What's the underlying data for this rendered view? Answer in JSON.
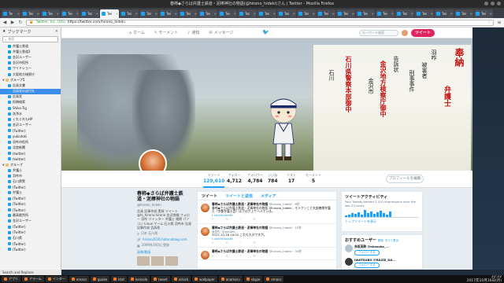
{
  "window": {
    "title": "春柿◆さらば弁護士鉄道・泥棒神社の物語(@hirono_hideki)さん | Twitter - Mozilla Firefox"
  },
  "tabs": [
    {
      "label": "Tw"
    },
    {
      "label": "Twi"
    },
    {
      "label": "Twi"
    },
    {
      "label": "Twi"
    },
    {
      "label": "Twi"
    },
    {
      "label": "Twi"
    },
    {
      "label": "Twi"
    },
    {
      "label": "Twi"
    },
    {
      "label": "Twi"
    },
    {
      "label": "Twi"
    },
    {
      "label": "Twi"
    },
    {
      "label": "Twi"
    },
    {
      "label": "Twi"
    },
    {
      "label": "Twi"
    },
    {
      "label": "Twi"
    },
    {
      "label": "Twi"
    },
    {
      "label": "Twi"
    },
    {
      "label": "Twi"
    },
    {
      "label": "Twi"
    },
    {
      "label": "Twi"
    },
    {
      "label": "Twi"
    },
    {
      "label": "Twi"
    },
    {
      "label": "Twi"
    },
    {
      "label": "Twi"
    },
    {
      "label": "Twi"
    }
  ],
  "navbar": {
    "back": "◀",
    "forward": "▶",
    "reload": "↻",
    "org": "Twitter, Inc. (US)",
    "url": "https://twitter.com/hirono_hideki"
  },
  "sidebar": {
    "title": "ブックマーク",
    "search_placeholder": "検索",
    "items": [
      {
        "label": "弁護士鉄道",
        "type": "hatena",
        "level": 1
      },
      {
        "label": "弁護士鉄道2",
        "type": "hatena",
        "level": 1
      },
      {
        "label": "金沢ユーザー",
        "type": "link",
        "level": 1
      },
      {
        "label": "金沢市役所",
        "type": "link",
        "level": 1
      },
      {
        "label": "ワイドショー",
        "type": "link",
        "level": 1
      },
      {
        "label": "大阪地方検察庁",
        "type": "link",
        "level": 1
      },
      {
        "label": "グループ5",
        "type": "folder",
        "level": 0
      },
      {
        "label": "告発文書",
        "type": "link",
        "level": 1
      },
      {
        "label": "告訴状の送付先",
        "type": "link",
        "level": 1,
        "selected": true
      },
      {
        "label": "告発状",
        "type": "link",
        "level": 1
      },
      {
        "label": "投稿検索",
        "type": "link",
        "level": 1
      },
      {
        "label": "Shiko-Tig",
        "type": "link",
        "level": 1
      },
      {
        "label": "洗浄水",
        "type": "link",
        "level": 1
      },
      {
        "label": "くれぐれもHP",
        "type": "link",
        "level": 1
      },
      {
        "label": "金沢ユーザー",
        "type": "link",
        "level": 1
      },
      {
        "label": "(Twitter)",
        "type": "link",
        "level": 1
      },
      {
        "label": "yukiotoki",
        "type": "link",
        "level": 1
      },
      {
        "label": "羽咋市役所",
        "type": "link",
        "level": 1
      },
      {
        "label": "北陸新聞",
        "type": "link",
        "level": 1
      },
      {
        "label": "(twitter)",
        "type": "link",
        "level": 1
      },
      {
        "label": "(twitter)",
        "type": "link",
        "level": 1
      },
      {
        "label": "グループ",
        "type": "folder",
        "level": 0
      },
      {
        "label": "弁護士",
        "type": "link",
        "level": 1
      },
      {
        "label": "羽咋市",
        "type": "link",
        "level": 1
      },
      {
        "label": "石川県警",
        "type": "link",
        "level": 1
      },
      {
        "label": "(Twitter)",
        "type": "link",
        "level": 1
      },
      {
        "label": "弁護士",
        "type": "link",
        "level": 1
      },
      {
        "label": "(Twitter)",
        "type": "link",
        "level": 1
      },
      {
        "label": "(Twitter)",
        "type": "link",
        "level": 1
      },
      {
        "label": "(Twitter)",
        "type": "link",
        "level": 1
      },
      {
        "label": "最高裁判所",
        "type": "link",
        "level": 1
      },
      {
        "label": "金沢ユーザー",
        "type": "link",
        "level": 1
      },
      {
        "label": "(Twitter)",
        "type": "link",
        "level": 1
      },
      {
        "label": "(Twitter)",
        "type": "link",
        "level": 1
      },
      {
        "label": "石川県",
        "type": "link",
        "level": 1
      },
      {
        "label": "(Twitter)",
        "type": "link",
        "level": 1
      },
      {
        "label": "(Twitter)",
        "type": "link",
        "level": 1
      }
    ]
  },
  "twitter_nav": {
    "home": "ホーム",
    "moments": "モーメント",
    "notifications": "通知",
    "messages": "メッセージ",
    "search_placeholder": "キーワード検索",
    "tweet_button": "ツイート"
  },
  "banner": {
    "col1": "奉納",
    "col2": "弁護士",
    "col3": "金沢地方検察庁御中",
    "col4": "石川県警察本部御中",
    "col5": "刑事事件",
    "col6": "羽咋",
    "col7": "被害者",
    "col8": "告訴状",
    "col9": "金沢市",
    "col10": "石川"
  },
  "stats": [
    {
      "label": "ツイート",
      "value": "129,610",
      "active": true
    },
    {
      "label": "フォロー",
      "value": "4,712"
    },
    {
      "label": "フォロワー",
      "value": "4,784"
    },
    {
      "label": "いいね",
      "value": "784"
    },
    {
      "label": "リスト",
      "value": "17"
    },
    {
      "label": "モーメント",
      "value": "5"
    }
  ],
  "edit_profile": "プロフィールを編集",
  "profile": {
    "name": "春柿◆さらば弁護士鉄道・泥棒神社の物語",
    "handle": "@hirono_hideki",
    "bio": "告発 記事作成 実録 ツイート @hi_hirono hirono 金沢地検 フォロー 羽咋 ツイッター 弁護士 検察 パソコン Linux ゲーム 石川県 羽咋市 告発 記事作成 告訴状",
    "location": "日本 石川県",
    "link": "hirono2016.hatenablog.com",
    "joined": "2009年10月に登録",
    "photos_header": "画像/動画"
  },
  "timeline": {
    "tab_tweets": "ツイート",
    "tab_replies": "ツイートと返信",
    "tab_media": "メディア",
    "tweets": [
      {
        "name": "春柿◆さらば弁護士鉄道・泥棒神社の物語",
        "handle": "@hirono_hideki · 6秒",
        "text": "春柿◆さらば弁護士鉄道・泥棒神社の物語 @hirono_hideki - モトケンこと矢部善朗弁護士（京都弁護士会）はブログ上でハメている。",
        "link": "t.co/xhironote"
      },
      {
        "name": "春柿◆さらば弁護士鉄道・泥棒神社の物語",
        "handle": "@hirono_hideki · 15秒",
        "text": "2017-10-16 10:04 これも大分ですが。",
        "link": "t.co/xhironote",
        "retweet": "返信先: @yjpubkt"
      },
      {
        "name": "春柿◆さらば弁護士鉄道・泥棒神社の物語",
        "handle": "@hirono_hideki · 30秒",
        "text": "",
        "link": "",
        "retweet": ""
      }
    ],
    "actions": [
      "↩",
      "⟲",
      "♡",
      "✉"
    ]
  },
  "activity": {
    "title": "ツイートアクティビティ",
    "desc": "Your Tweets earned 3,410 impressions over the last 24 hours",
    "link": "トップツイートを表示",
    "bars": [
      0.2,
      0.3,
      0.5,
      0.4,
      0.6,
      0.3,
      0.9,
      0.5,
      0.7,
      0.4,
      0.6,
      0.8,
      0.5,
      0.3,
      0.7
    ]
  },
  "recommendations": {
    "title": "おすすめユーザー",
    "refresh": "更新",
    "all": "すべて表示",
    "users": [
      {
        "name": "赤坂英幹 @akasaka_...",
        "follow": "フォローする"
      },
      {
        "name": "IWATSUBO @RAIZE_DA...",
        "follow": "フォローする"
      }
    ]
  },
  "status": {
    "text": "Search and Replace"
  },
  "taskbar": {
    "items": [
      "アプリ",
      "アラーム",
      "インター",
      "emacs",
      "guake",
      "ktxt",
      "konsole",
      "tweet",
      "xclock",
      "wallpaper",
      "anamaru",
      "skype",
      "emacs"
    ],
    "time": "22:22",
    "date": "2017年10月16日(月)"
  }
}
